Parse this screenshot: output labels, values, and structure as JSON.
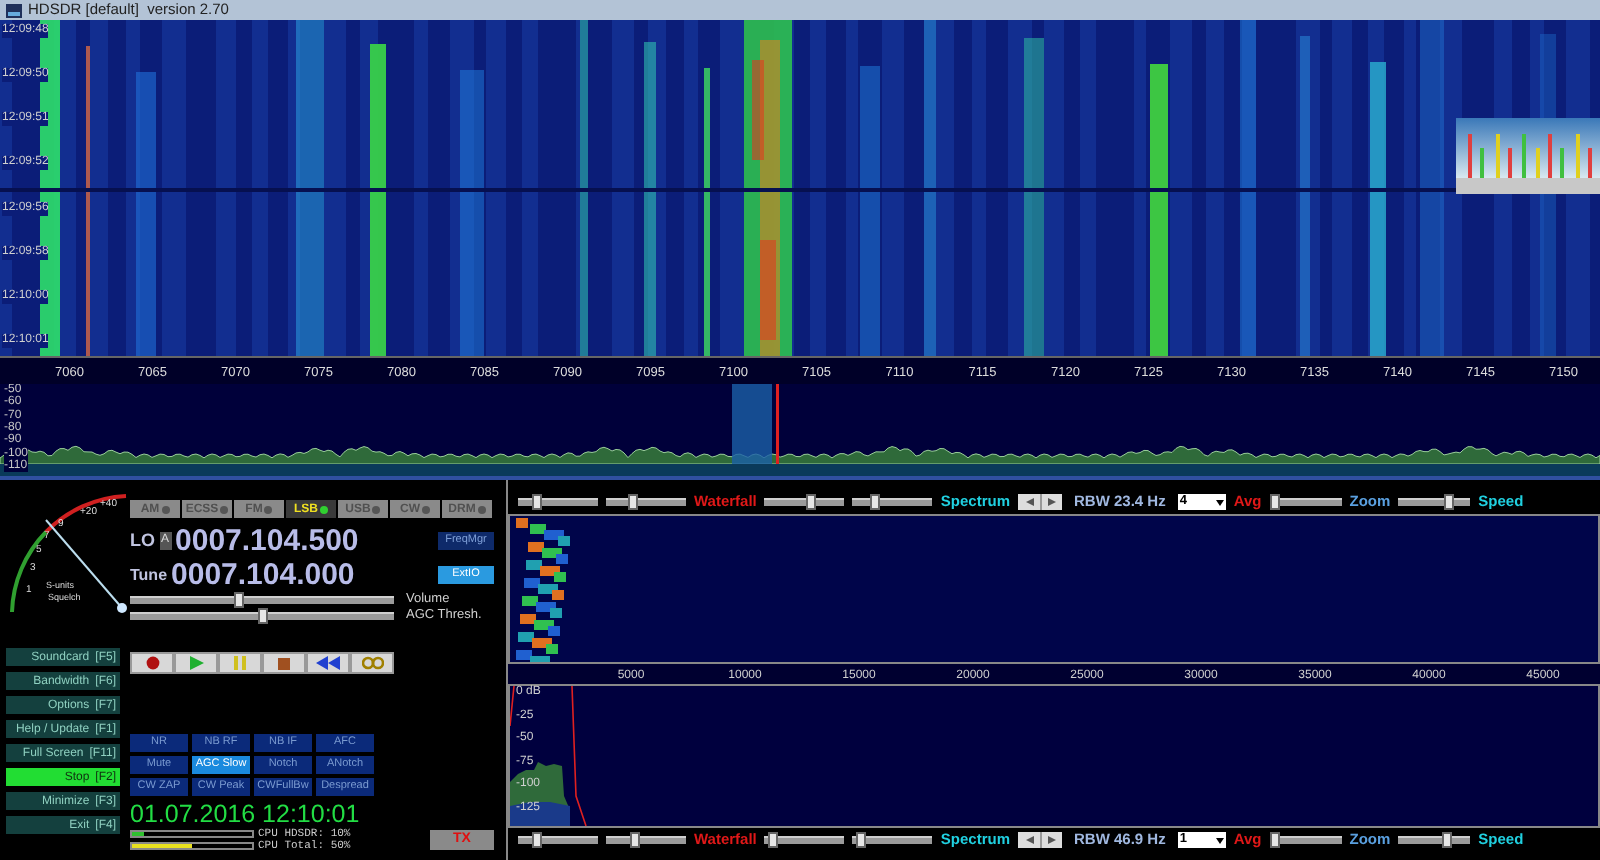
{
  "window": {
    "title": "HDSDR [default]  version 2.70"
  },
  "waterfall": {
    "times": [
      "12:09:48",
      "12:09:50",
      "12:09:51",
      "12:09:52",
      "12:09:56",
      "12:09:58",
      "12:10:00",
      "12:10:01"
    ]
  },
  "frequency_axis": {
    "labels": [
      "7060",
      "7065",
      "7070",
      "7075",
      "7080",
      "7085",
      "7090",
      "7095",
      "7100",
      "7105",
      "7110",
      "7115",
      "7120",
      "7125",
      "7130",
      "7135",
      "7140",
      "7145",
      "7150"
    ]
  },
  "spectrum": {
    "db_labels": [
      "-50",
      "-60",
      "-70",
      "-80",
      "-90",
      "-100",
      "-110"
    ]
  },
  "s_meter": {
    "scale": [
      "1",
      "3",
      "5",
      "7",
      "9",
      "+20",
      "+40"
    ],
    "label": "S-units",
    "sublabel": "Squelch"
  },
  "modes": [
    {
      "label": "AM",
      "selected": false
    },
    {
      "label": "ECSS",
      "selected": false
    },
    {
      "label": "FM",
      "selected": false
    },
    {
      "label": "LSB",
      "selected": true
    },
    {
      "label": "USB",
      "selected": false
    },
    {
      "label": "CW",
      "selected": false
    },
    {
      "label": "DRM",
      "selected": false
    }
  ],
  "lo": {
    "label": "LO",
    "bank": "A",
    "frequency": "0007.104.500"
  },
  "tune": {
    "label": "Tune",
    "frequency": "0007.104.000"
  },
  "side_buttons": [
    {
      "label": "FreqMgr",
      "active": false
    },
    {
      "label": "ExtIO",
      "active": true
    }
  ],
  "sliders": [
    {
      "label": "Volume",
      "level": 0.41
    },
    {
      "label": "AGC Thresh.",
      "level": 0.5
    }
  ],
  "transport": [
    {
      "kind": "record"
    },
    {
      "kind": "play"
    },
    {
      "kind": "pause"
    },
    {
      "kind": "stop"
    },
    {
      "kind": "rewind"
    },
    {
      "kind": "loop"
    }
  ],
  "function_keys": [
    {
      "label": "Soundcard",
      "key": "[F5]",
      "active": false
    },
    {
      "label": "Bandwidth",
      "key": "[F6]",
      "active": false
    },
    {
      "label": "Options",
      "key": "[F7]",
      "active": false
    },
    {
      "label": "Help / Update",
      "key": "[F1]",
      "active": false
    },
    {
      "label": "Full Screen",
      "key": "[F11]",
      "active": false
    },
    {
      "label": "Stop",
      "key": "[F2]",
      "active": true
    },
    {
      "label": "Minimize",
      "key": "[F3]",
      "active": false
    },
    {
      "label": "Exit",
      "key": "[F4]",
      "active": false
    }
  ],
  "dsp_buttons": [
    {
      "label": "NR",
      "selected": false
    },
    {
      "label": "NB RF",
      "selected": false
    },
    {
      "label": "NB IF",
      "selected": false
    },
    {
      "label": "AFC",
      "selected": false
    },
    {
      "label": "Mute",
      "selected": false
    },
    {
      "label": "AGC Slow",
      "selected": true
    },
    {
      "label": "Notch",
      "selected": false
    },
    {
      "label": "ANotch",
      "selected": false
    },
    {
      "label": "CW ZAP",
      "selected": false
    },
    {
      "label": "CW Peak",
      "selected": false
    },
    {
      "label": "CWFullBw",
      "selected": false
    },
    {
      "label": "Despread",
      "selected": false
    }
  ],
  "clock": "01.07.2016 12:10:01",
  "cpu": [
    {
      "label": "CPU HDSDR:",
      "value": "10%",
      "level": 0.1
    },
    {
      "label": "CPU Total:",
      "value": "50%",
      "level": 0.5
    }
  ],
  "tx_button": "TX",
  "audio_toolbars": [
    {
      "sliders": [
        {
          "level": 0.2
        },
        {
          "level": 0.3
        },
        {
          "level": 0.6
        },
        {
          "level": 0.25
        },
        {
          "level": 0.0
        },
        {
          "level": 0.75
        }
      ],
      "waterfall_label": "Waterfall",
      "spectrum_label": "Spectrum",
      "rbw": "RBW 23.4 Hz",
      "avg_value": "4",
      "avg_label": "Avg",
      "zoom_label": "Zoom",
      "speed_label": "Speed"
    },
    {
      "sliders": [
        {
          "level": 0.2
        },
        {
          "level": 0.35
        },
        {
          "level": 0.05
        },
        {
          "level": 0.05
        },
        {
          "level": 0.0
        },
        {
          "level": 0.7
        }
      ],
      "waterfall_label": "Waterfall",
      "spectrum_label": "Spectrum",
      "rbw": "RBW 46.9 Hz",
      "avg_value": "1",
      "avg_label": "Avg",
      "zoom_label": "Zoom",
      "speed_label": "Speed"
    }
  ],
  "audio_axis": {
    "labels": [
      "5000",
      "10000",
      "15000",
      "20000",
      "25000",
      "30000",
      "35000",
      "40000",
      "45000"
    ]
  },
  "audio_spectrum": {
    "db_labels": [
      "0 dB",
      "-25",
      "-50",
      "-75",
      "-100",
      "-125"
    ]
  }
}
